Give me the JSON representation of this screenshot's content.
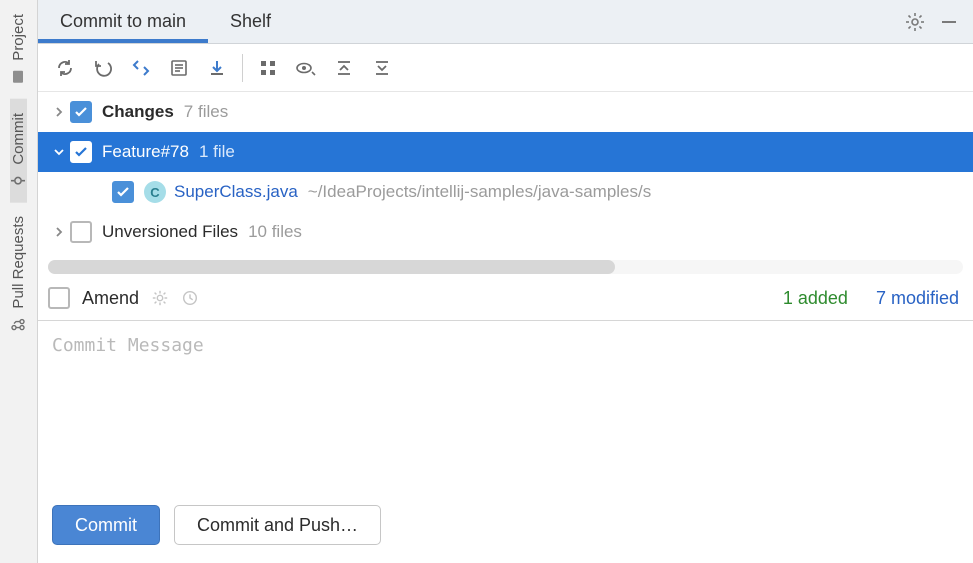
{
  "sidebar": {
    "tabs": [
      {
        "label": "Project",
        "icon": "project-icon"
      },
      {
        "label": "Commit",
        "icon": "commit-icon"
      },
      {
        "label": "Pull Requests",
        "icon": "pull-requests-icon"
      }
    ]
  },
  "tabs": {
    "commit": "Commit to main",
    "shelf": "Shelf"
  },
  "tree": {
    "changes": {
      "label": "Changes",
      "count": "7 files"
    },
    "changelist": {
      "label": "Feature#78",
      "count": "1 file"
    },
    "file": {
      "name": "SuperClass.java",
      "path": "~/IdeaProjects/intellij-samples/java-samples/s"
    },
    "unversioned": {
      "label": "Unversioned Files",
      "count": "10 files"
    }
  },
  "amend": {
    "label": "Amend"
  },
  "stats": {
    "added": "1 added",
    "modified": "7 modified"
  },
  "message": {
    "placeholder": "Commit Message"
  },
  "buttons": {
    "commit": "Commit",
    "commit_push": "Commit and Push…"
  }
}
